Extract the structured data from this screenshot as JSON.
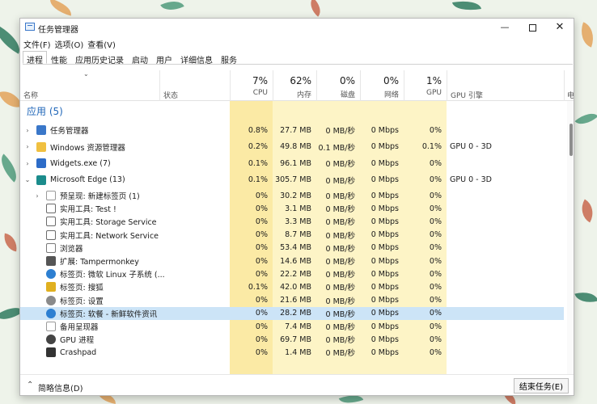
{
  "window": {
    "title": "任务管理器"
  },
  "menu": [
    "文件(F)",
    "选项(O)",
    "查看(V)"
  ],
  "tabs": [
    {
      "label": "进程",
      "active": true
    },
    {
      "label": "性能"
    },
    {
      "label": "应用历史记录"
    },
    {
      "label": "启动"
    },
    {
      "label": "用户"
    },
    {
      "label": "详细信息"
    },
    {
      "label": "服务"
    }
  ],
  "columns": {
    "name": "名称",
    "status": "状态",
    "cpu": {
      "percent": "7%",
      "label": "CPU"
    },
    "memory": {
      "percent": "62%",
      "label": "内存"
    },
    "disk": {
      "percent": "0%",
      "label": "磁盘"
    },
    "network": {
      "percent": "0%",
      "label": "网络"
    },
    "gpu": {
      "percent": "1%",
      "label": "GPU"
    },
    "gpu_engine": "GPU 引擎",
    "power": "电"
  },
  "group_title": "应用 (5)",
  "processes": [
    {
      "name": "任务管理器",
      "cpu": "0.8%",
      "mem": "27.7 MB",
      "disk": "0 MB/秒",
      "net": "0 Mbps",
      "gpu": "0%",
      "gpu_engine": "",
      "icon": "taskmgr-icon",
      "expander": "›"
    },
    {
      "name": "Windows 资源管理器",
      "cpu": "0.2%",
      "mem": "49.8 MB",
      "disk": "0.1 MB/秒",
      "net": "0 Mbps",
      "gpu": "0.1%",
      "gpu_engine": "GPU 0 - 3D",
      "icon": "folder-icon",
      "expander": "›"
    },
    {
      "name": "Widgets.exe (7)",
      "cpu": "0.1%",
      "mem": "96.1 MB",
      "disk": "0 MB/秒",
      "net": "0 Mbps",
      "gpu": "0%",
      "gpu_engine": "",
      "icon": "widgets-icon",
      "expander": "›"
    },
    {
      "name": "Microsoft Edge (13)",
      "cpu": "0.1%",
      "mem": "305.7 MB",
      "disk": "0 MB/秒",
      "net": "0 Mbps",
      "gpu": "0%",
      "gpu_engine": "GPU 0 - 3D",
      "icon": "edge-icon",
      "expander": "⌄"
    }
  ],
  "subprocesses": [
    {
      "name": "预呈现: 新建标签页 (1)",
      "cpu": "0%",
      "mem": "30.2 MB",
      "disk": "0 MB/秒",
      "net": "0 Mbps",
      "gpu": "0%",
      "icon": "page-icon",
      "expander": "›"
    },
    {
      "name": "实用工具: Test !",
      "cpu": "0%",
      "mem": "3.1 MB",
      "disk": "0 MB/秒",
      "net": "0 Mbps",
      "gpu": "0%",
      "icon": "utility-icon",
      "expander": ""
    },
    {
      "name": "实用工具: Storage Service",
      "cpu": "0%",
      "mem": "3.3 MB",
      "disk": "0 MB/秒",
      "net": "0 Mbps",
      "gpu": "0%",
      "icon": "utility-icon",
      "expander": ""
    },
    {
      "name": "实用工具: Network Service",
      "cpu": "0%",
      "mem": "8.7 MB",
      "disk": "0 MB/秒",
      "net": "0 Mbps",
      "gpu": "0%",
      "icon": "utility-icon",
      "expander": ""
    },
    {
      "name": "浏览器",
      "cpu": "0%",
      "mem": "53.4 MB",
      "disk": "0 MB/秒",
      "net": "0 Mbps",
      "gpu": "0%",
      "icon": "browser-icon",
      "expander": ""
    },
    {
      "name": "扩展: Tampermonkey",
      "cpu": "0%",
      "mem": "14.6 MB",
      "disk": "0 MB/秒",
      "net": "0 Mbps",
      "gpu": "0%",
      "icon": "extension-icon",
      "expander": ""
    },
    {
      "name": "标签页: 微软 Linux 子系统 (...",
      "cpu": "0%",
      "mem": "22.2 MB",
      "disk": "0 MB/秒",
      "net": "0 Mbps",
      "gpu": "0%",
      "icon": "tab-blue-icon",
      "expander": ""
    },
    {
      "name": "标签页: 搜狐",
      "cpu": "0.1%",
      "mem": "42.0 MB",
      "disk": "0 MB/秒",
      "net": "0 Mbps",
      "gpu": "0%",
      "icon": "sohu-icon",
      "expander": ""
    },
    {
      "name": "标签页: 设置",
      "cpu": "0%",
      "mem": "21.6 MB",
      "disk": "0 MB/秒",
      "net": "0 Mbps",
      "gpu": "0%",
      "icon": "settings-icon",
      "expander": ""
    },
    {
      "name": "标签页: 软餐 - 新鲜软件资讯",
      "cpu": "0%",
      "mem": "28.2 MB",
      "disk": "0 MB/秒",
      "net": "0 Mbps",
      "gpu": "0%",
      "icon": "tab-blue-icon",
      "expander": "",
      "selected": true
    },
    {
      "name": "备用呈现器",
      "cpu": "0%",
      "mem": "7.4 MB",
      "disk": "0 MB/秒",
      "net": "0 Mbps",
      "gpu": "0%",
      "icon": "page-icon",
      "expander": ""
    },
    {
      "name": "GPU 进程",
      "cpu": "0%",
      "mem": "69.7 MB",
      "disk": "0 MB/秒",
      "net": "0 Mbps",
      "gpu": "0%",
      "icon": "gear-icon",
      "expander": ""
    },
    {
      "name": "Crashpad",
      "cpu": "0%",
      "mem": "1.4 MB",
      "disk": "0 MB/秒",
      "net": "0 Mbps",
      "gpu": "0%",
      "icon": "crashpad-icon",
      "expander": ""
    }
  ],
  "status": {
    "toggle": "简略信息(D)",
    "end_task": "结束任务(E)"
  },
  "colors": {
    "cpu_heat": "#fbeaa5",
    "heat": "#fdf4c6",
    "selected": "#cce4f7",
    "group_title": "#1f66b8"
  }
}
